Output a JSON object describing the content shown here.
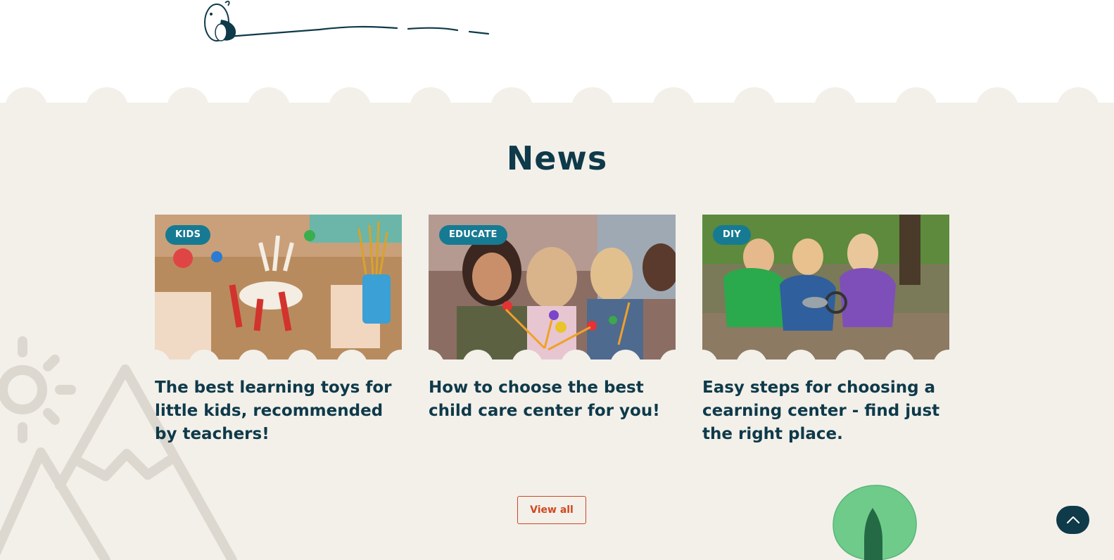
{
  "colors": {
    "background": "#f3f0ea",
    "heading": "#0e3a4a",
    "tag": "#177a93",
    "accent": "#d1471f",
    "deco": "#dcd8d0"
  },
  "news": {
    "title": "News",
    "view_all_label": "View all",
    "cards": [
      {
        "tag": "KIDS",
        "title": "The best learning toys for little kids, recommended by teachers!"
      },
      {
        "tag": "EDUCATE",
        "title": "How to choose the best child care center for you!"
      },
      {
        "tag": "DIY",
        "title": "Easy steps for choosing a cearning center - find just the right place."
      }
    ]
  },
  "icons": {
    "bee": "bee-icon",
    "scroll_top": "chevron-up-icon",
    "sun": "sun-icon",
    "mountains": "mountains-icon",
    "tree": "tree-icon"
  }
}
